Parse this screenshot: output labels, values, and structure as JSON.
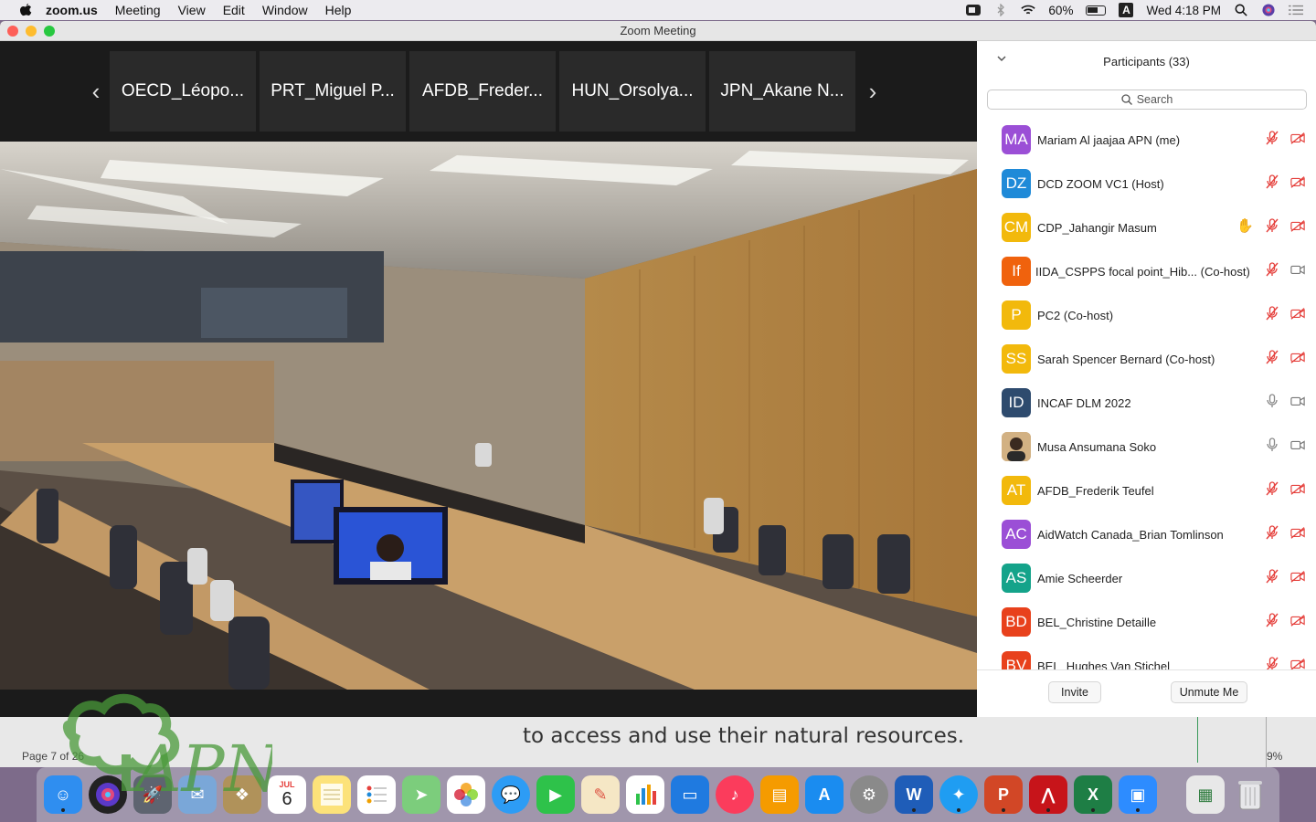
{
  "menubar": {
    "app": "zoom.us",
    "menus": [
      "Meeting",
      "View",
      "Edit",
      "Window",
      "Help"
    ],
    "battery": "60%",
    "input_source": "A",
    "clock": "Wed 4:18 PM"
  },
  "window": {
    "title": "Zoom Meeting"
  },
  "strip": {
    "tiles": [
      "OECD_Léopo...",
      "PRT_Miguel P...",
      "AFDB_Freder...",
      "HUN_Orsolya...",
      "JPN_Akane N..."
    ],
    "prev": "‹",
    "next": "›"
  },
  "participants": {
    "title": "Participants (33)",
    "search_label": "Search",
    "rows": [
      {
        "initials": "MA",
        "name": "Mariam Al jaajaa APN (me)",
        "color": "#9b4fd6"
      },
      {
        "initials": "DZ",
        "name": "DCD ZOOM VC1 (Host)",
        "color": "#1f8ad8"
      },
      {
        "initials": "CM",
        "name": "CDP_Jahangir Masum",
        "color": "#f2b90c"
      },
      {
        "initials": "If",
        "name": "IIDA_CSPPS focal point_Hib... (Co-host)",
        "color": "#f0620d"
      },
      {
        "initials": "P",
        "name": "PC2 (Co-host)",
        "color": "#f2b90c"
      },
      {
        "initials": "SS",
        "name": "Sarah Spencer Bernard (Co-host)",
        "color": "#f2b90c"
      },
      {
        "initials": "ID",
        "name": "INCAF DLM 2022",
        "color": "#2e4b6e"
      },
      {
        "initials": "",
        "name": "Musa Ansumana Soko",
        "color": "#c9a070"
      },
      {
        "initials": "AT",
        "name": "AFDB_Frederik Teufel",
        "color": "#f2b90c"
      },
      {
        "initials": "AC",
        "name": "AidWatch Canada_Brian Tomlinson",
        "color": "#9b4fd6"
      },
      {
        "initials": "AS",
        "name": "Amie Scheerder",
        "color": "#14a38a"
      },
      {
        "initials": "BD",
        "name": "BEL_Christine Detaille",
        "color": "#e8411c"
      },
      {
        "initials": "BV",
        "name": "BEL_Hughes Van Stichel",
        "color": "#e8411c"
      }
    ],
    "invite_label": "Invite",
    "unmute_label": "Unmute Me"
  },
  "background_doc": {
    "text": "to access and use their natural resources.",
    "page_label": "Page 7 of 26",
    "zoom": "9%"
  },
  "dock": {
    "calendar_month": "JUL",
    "calendar_day": "6"
  }
}
